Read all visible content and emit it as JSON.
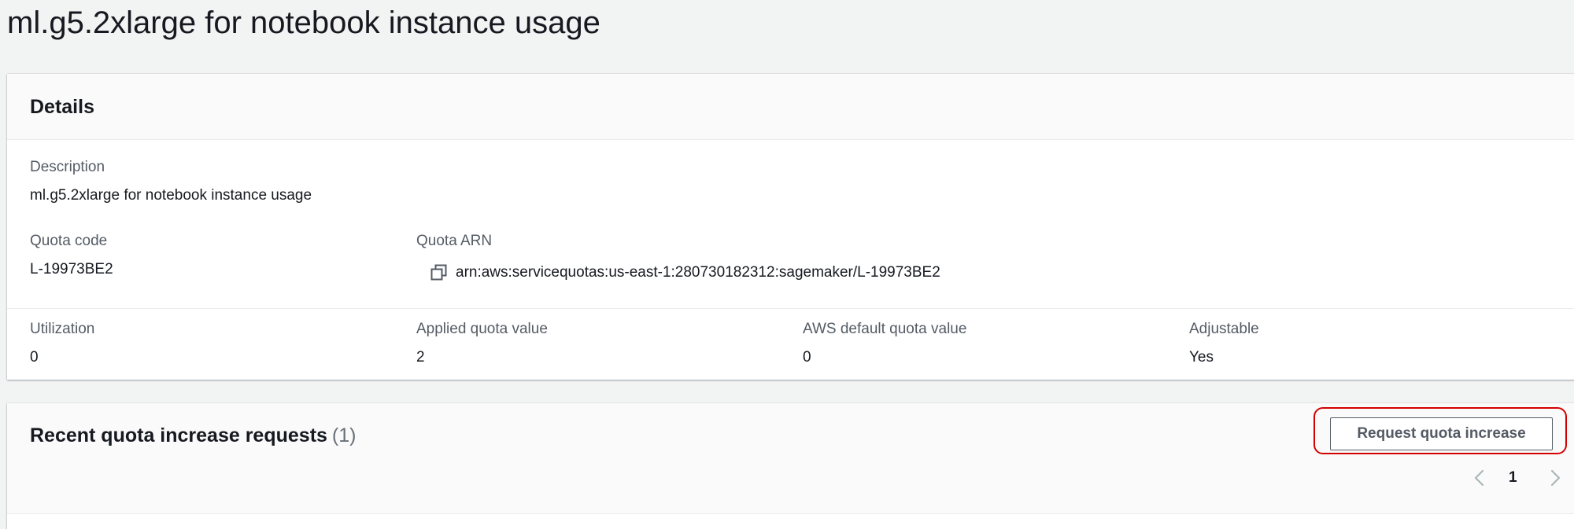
{
  "page": {
    "title": "ml.g5.2xlarge for notebook instance usage"
  },
  "details": {
    "heading": "Details",
    "description_label": "Description",
    "description_value": "ml.g5.2xlarge for notebook instance usage",
    "quota_code_label": "Quota code",
    "quota_code_value": "L-19973BE2",
    "quota_arn_label": "Quota ARN",
    "quota_arn_value": "arn:aws:servicequotas:us-east-1:280730182312:sagemaker/L-19973BE2",
    "utilization_label": "Utilization",
    "utilization_value": "0",
    "applied_quota_label": "Applied quota value",
    "applied_quota_value": "2",
    "default_quota_label": "AWS default quota value",
    "default_quota_value": "0",
    "adjustable_label": "Adjustable",
    "adjustable_value": "Yes"
  },
  "requests": {
    "heading": "Recent quota increase requests",
    "count": "(1)",
    "request_button_label": "Request quota increase",
    "pagination": {
      "current_page": "1"
    }
  },
  "icons": {
    "copy": "copy-icon",
    "prev": "chevron-left-icon",
    "next": "chevron-right-icon"
  },
  "colors": {
    "highlight": "#d40000",
    "background": "#f2f3f3"
  }
}
